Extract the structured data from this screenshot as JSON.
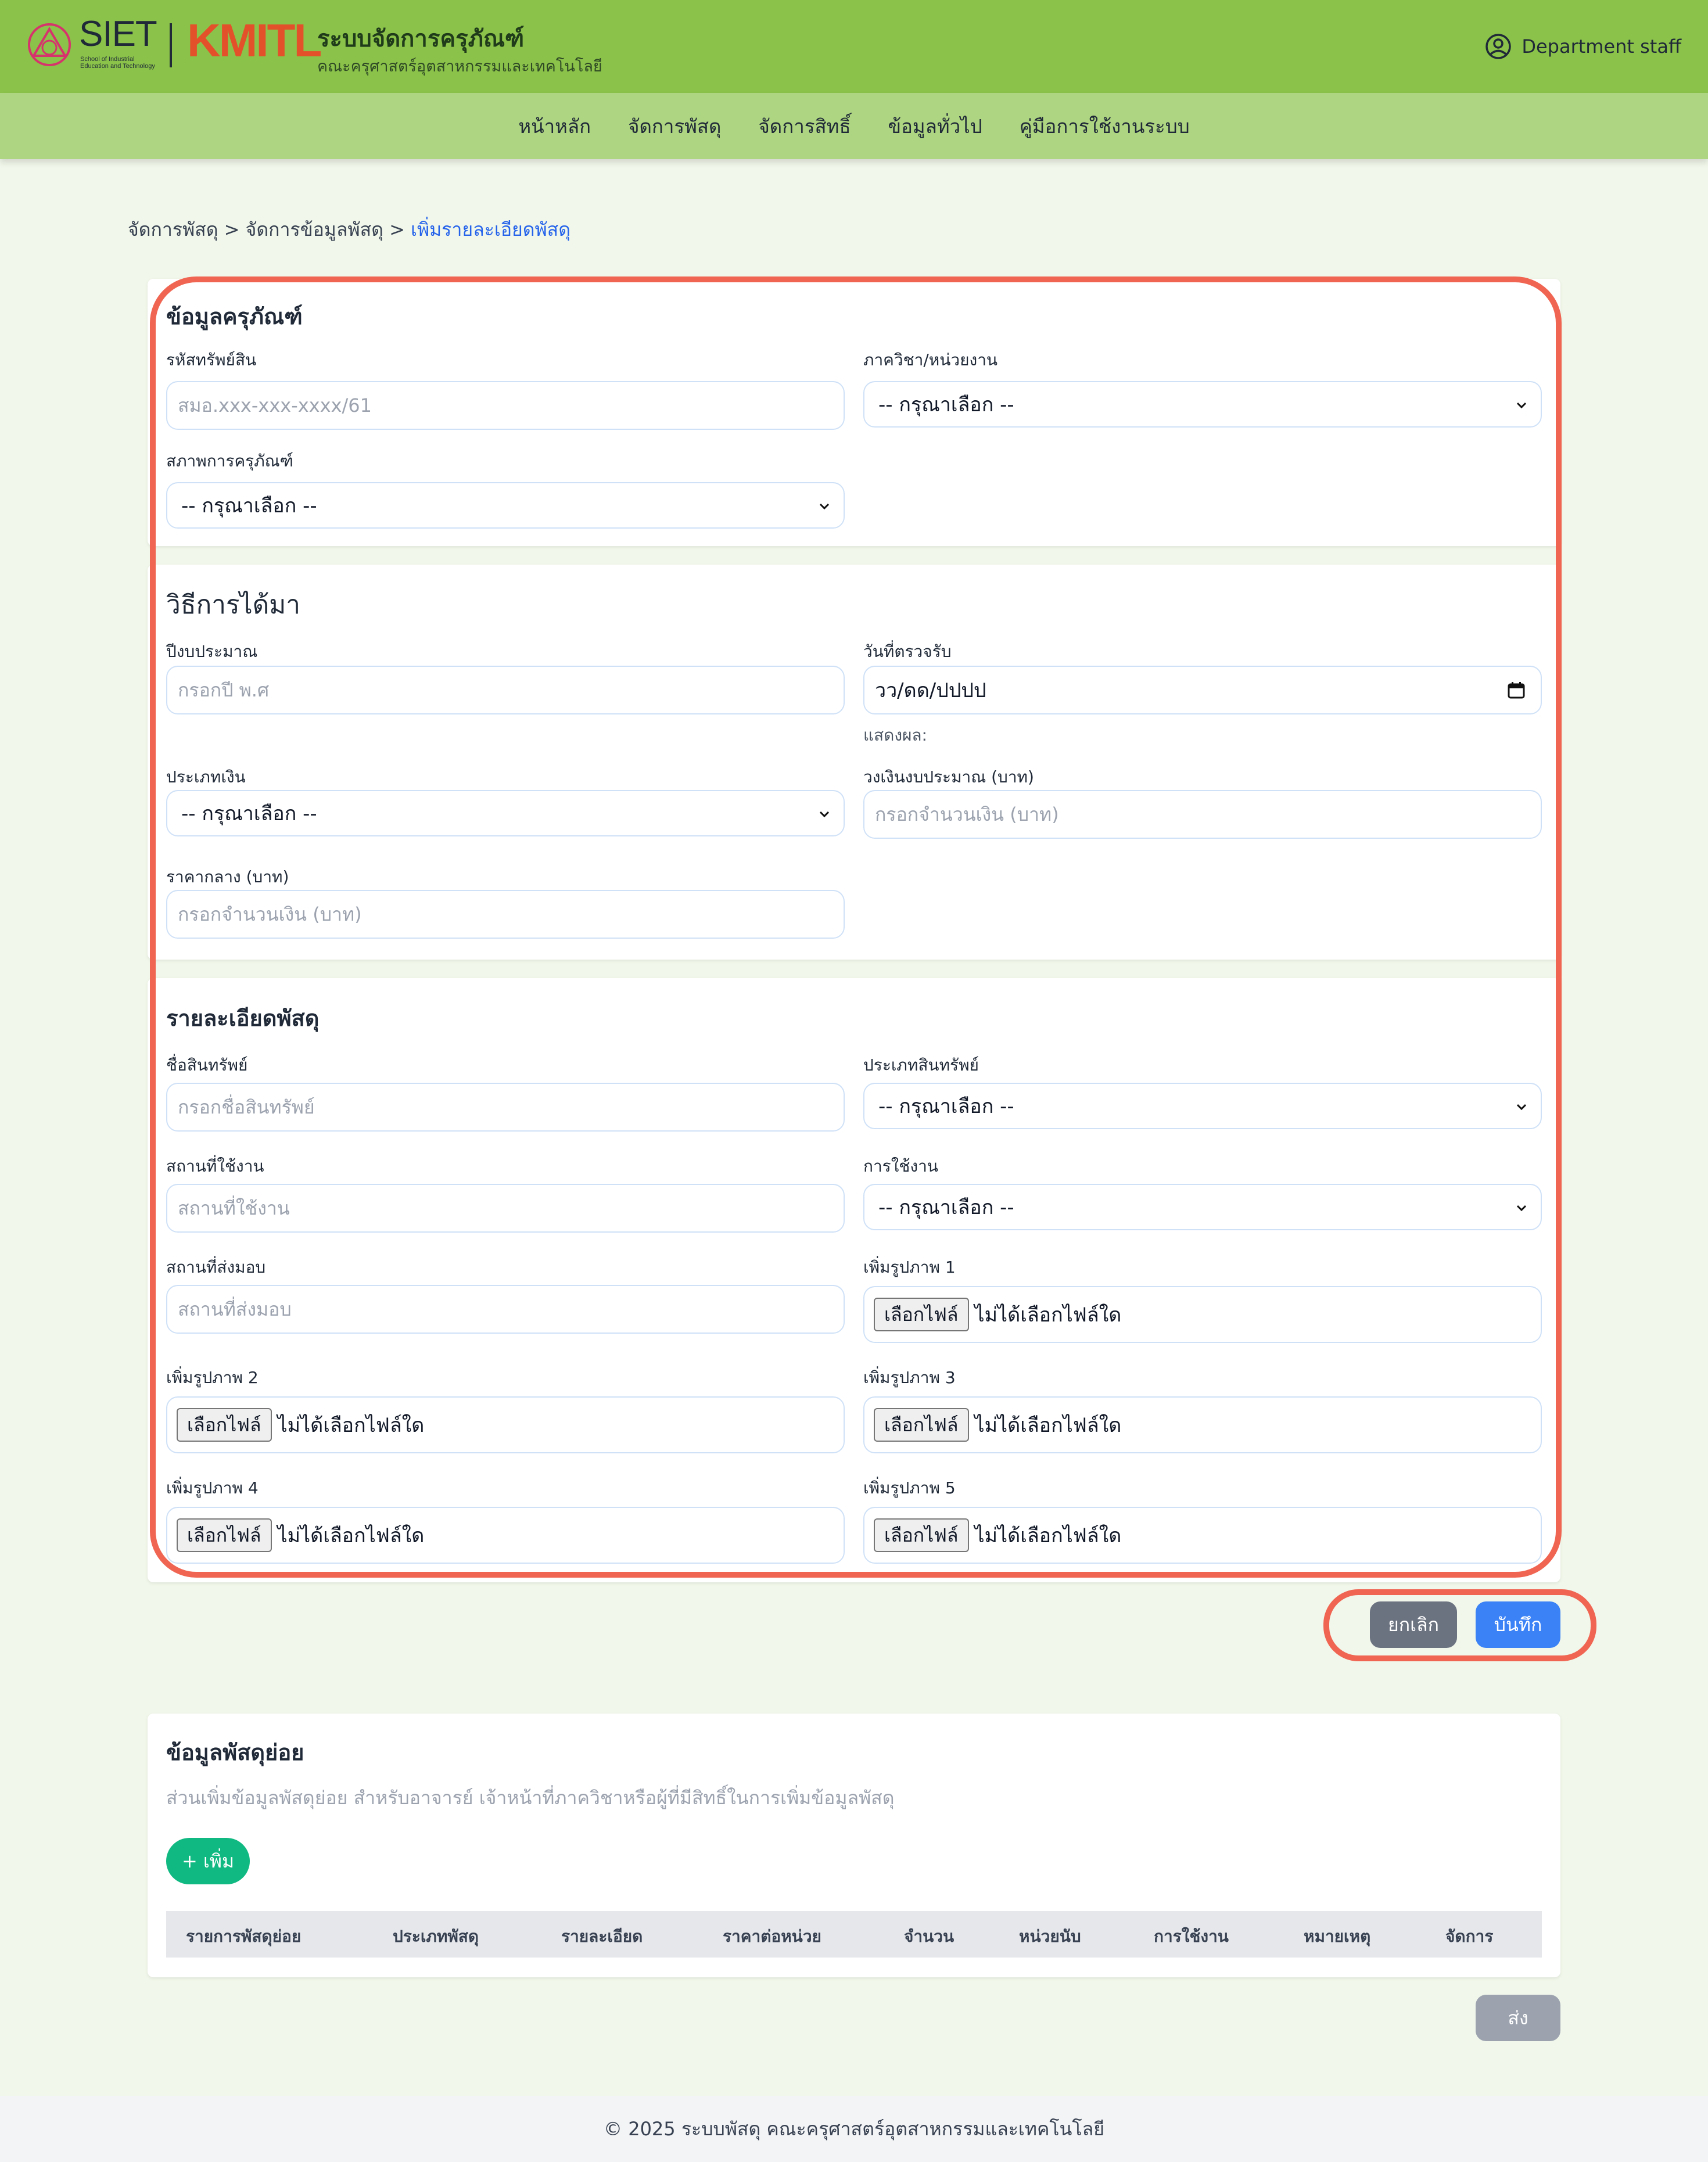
{
  "header": {
    "logo_siet": "SIET",
    "logo_siet_sub": "School of Industrial Education and Technology",
    "logo_kmitl": "KMITL",
    "app_title": "ระบบจัดการครุภัณฑ์",
    "app_subtitle": "คณะครุศาสตร์อุตสาหกรรมและเทคโนโลยี",
    "user_label": "Department staff"
  },
  "nav": {
    "items": [
      "หน้าหลัก",
      "จัดการพัสดุ",
      "จัดการสิทธิ์",
      "ข้อมูลทั่วไป",
      "คู่มือการใช้งานระบบ"
    ]
  },
  "breadcrumb": {
    "item1": "จัดการพัสดุ",
    "sep": ">",
    "item2": "จัดการข้อมูลพัสดุ",
    "item3": "เพิ่มรายละเอียดพัสดุ"
  },
  "section_equipment": {
    "title": "ข้อมูลครุภัณฑ์",
    "asset_code_label": "รหัสทรัพย์สิน",
    "asset_code_placeholder": "สมอ.xxx-xxx-xxxx/61",
    "department_label": "ภาควิชา/หน่วยงาน",
    "department_value": "-- กรุณาเลือก --",
    "condition_label": "สภาพการครุภัณฑ์",
    "condition_value": "-- กรุณาเลือก --"
  },
  "section_acquisition": {
    "title": "วิธีการได้มา",
    "budget_year_label": "ปีงบประมาณ",
    "budget_year_placeholder": "กรอกปี พ.ศ",
    "inspect_date_label": "วันที่ตรวจรับ",
    "inspect_date_value": "วว/ดด/ปปปป",
    "display_hint": "แสดงผล:",
    "money_type_label": "ประเภทเงิน",
    "money_type_value": "-- กรุณาเลือก --",
    "budget_amount_label": "วงเงินงบประมาณ (บาท)",
    "budget_amount_placeholder": "กรอกจำนวนเงิน (บาท)",
    "median_price_label": "ราคากลาง (บาท)",
    "median_price_placeholder": "กรอกจำนวนเงิน (บาท)"
  },
  "section_details": {
    "title": "รายละเอียดพัสดุ",
    "asset_name_label": "ชื่อสินทรัพย์",
    "asset_name_placeholder": "กรอกชื่อสินทรัพย์",
    "asset_type_label": "ประเภทสินทรัพย์",
    "asset_type_value": "-- กรุณาเลือก --",
    "location_label": "สถานที่ใช้งาน",
    "location_placeholder": "สถานที่ใช้งาน",
    "usage_label": "การใช้งาน",
    "usage_value": "-- กรุณาเลือก --",
    "delivery_label": "สถานที่ส่งมอบ",
    "delivery_placeholder": "สถานที่ส่งมอบ",
    "image1_label": "เพิ่มรูปภาพ 1",
    "image2_label": "เพิ่มรูปภาพ 2",
    "image3_label": "เพิ่มรูปภาพ 3",
    "image4_label": "เพิ่มรูปภาพ 4",
    "image5_label": "เพิ่มรูปภาพ 5",
    "file_button": "เลือกไฟล์",
    "no_file": "ไม่ได้เลือกไฟล์ใด"
  },
  "actions": {
    "cancel": "ยกเลิก",
    "save": "บันทึก"
  },
  "sub_items": {
    "title": "ข้อมูลพัสดุย่อย",
    "description": "ส่วนเพิ่มข้อมูลพัสดุย่อย สำหรับอาจารย์ เจ้าหน้าที่ภาควิชาหรือผู้ที่มีสิทธิ์ในการเพิ่มข้อมูลพัสดุ",
    "add_button": "+ เพิ่ม",
    "columns": [
      "รายการพัสดุย่อย",
      "ประเภทพัสดุ",
      "รายละเอียด",
      "ราคาต่อหน่วย",
      "จำนวน",
      "หน่วยนับ",
      "การใช้งาน",
      "หมายเหตุ",
      "จัดการ"
    ],
    "submit_button": "ส่ง"
  },
  "footer": {
    "text": "© 2025 ระบบพัสดุ คณะครุศาสตร์อุตสาหกรรมและเทคโนโลยี"
  },
  "colors": {
    "header_bg": "#8bc34a",
    "nav_bg": "#aed581",
    "page_bg": "#f1f7ea",
    "highlight": "#f06552",
    "primary": "#3b82f6",
    "success": "#10b981",
    "secondary": "#6b7280",
    "link": "#2563eb"
  }
}
